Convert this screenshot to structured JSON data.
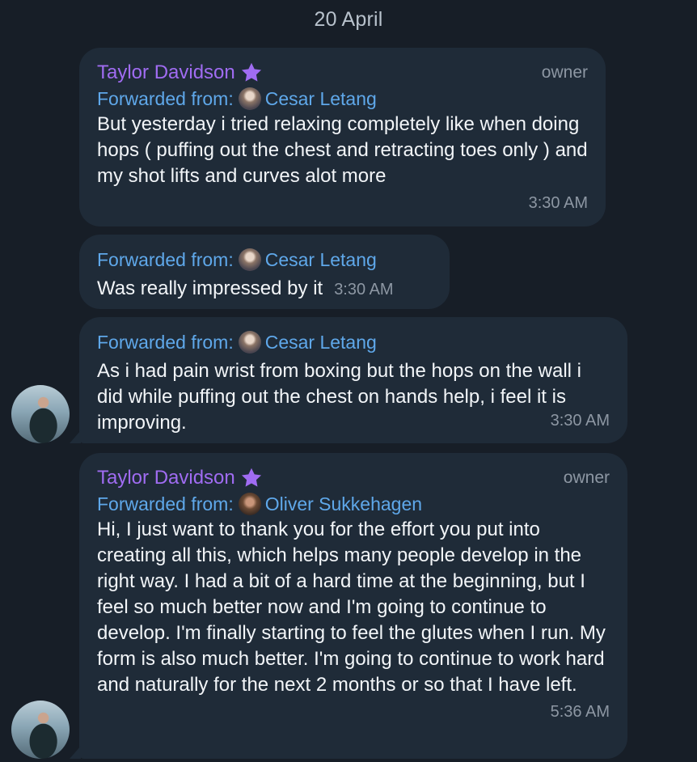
{
  "date_separator": "20 April",
  "messages": [
    {
      "sender": "Taylor Davidson",
      "role": "owner",
      "forwarded_label": "Forwarded from:",
      "forwarded_name": "Cesar Letang",
      "text": "But yesterday i tried relaxing completely like when doing hops ( puffing out the chest and retracting toes only ) and my shot lifts and curves alot more",
      "time": "3:30 AM"
    },
    {
      "forwarded_label": "Forwarded from:",
      "forwarded_name": "Cesar Letang",
      "text": "Was really impressed by it",
      "time": "3:30 AM"
    },
    {
      "forwarded_label": "Forwarded from:",
      "forwarded_name": "Cesar Letang",
      "text": "As i had pain wrist from boxing but the hops on the wall i did while puffing out the chest on hands help, i feel it is improving.",
      "time": "3:30 AM"
    },
    {
      "sender": "Taylor Davidson",
      "role": "owner",
      "forwarded_label": "Forwarded from:",
      "forwarded_name": "Oliver Sukkehagen",
      "text": "Hi, I just want to thank you for the effort you put into creating all this, which helps many people develop in the right way. I had a bit of a hard time at the beginning, but I feel so much better now and I'm going to continue to develop. I'm finally starting to feel the glutes when I run. My form is also much better. I'm going to continue to work hard and naturally for the next 2 months or so that I have left.",
      "time": "5:36 AM"
    }
  ],
  "colors": {
    "background": "#171e27",
    "bubble": "#1f2b38",
    "sender_name": "#a06cf2",
    "forward_link": "#5fa8ea",
    "meta_text": "#8d97a3"
  },
  "icons": {
    "premium_badge": "star-icon"
  }
}
